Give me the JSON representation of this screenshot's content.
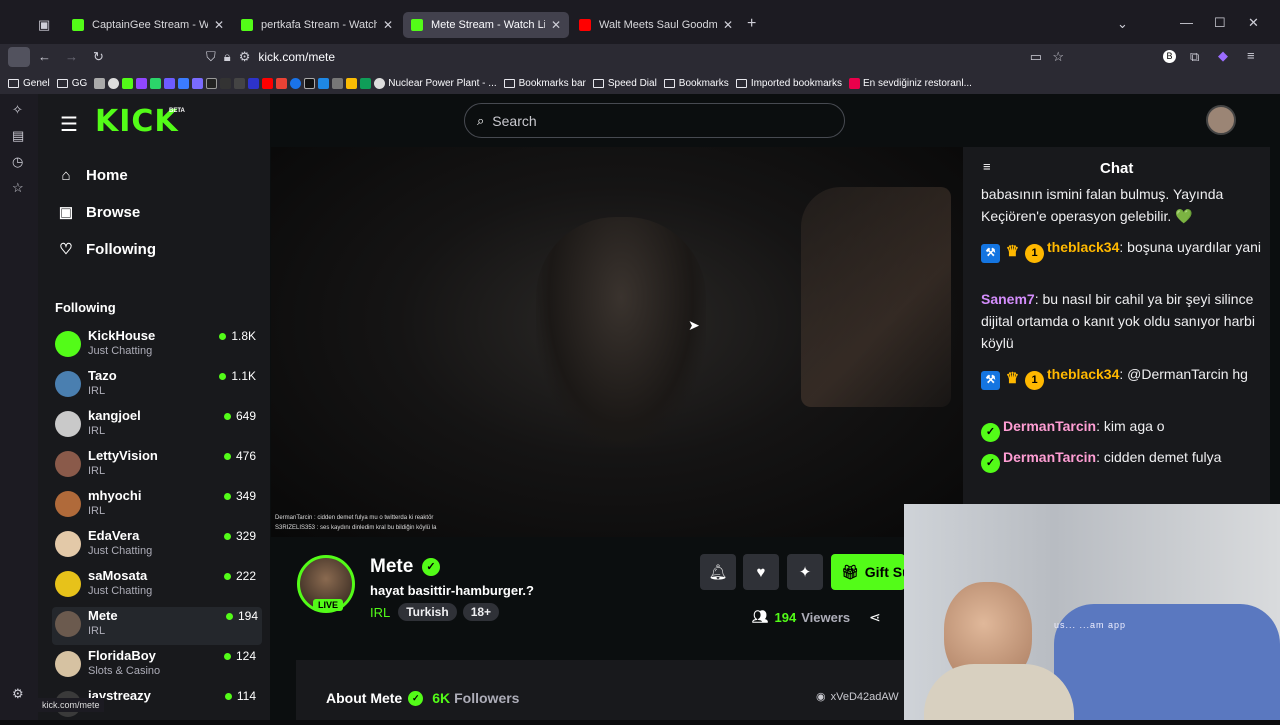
{
  "browser": {
    "tabs": [
      {
        "title": "CaptainGee Stream - Watch Live",
        "color": "#53fc18"
      },
      {
        "title": "pertkafa Stream - Watch Live o",
        "color": "#53fc18"
      },
      {
        "title": "Mete Stream - Watch Live on Ki",
        "color": "#53fc18",
        "active": true
      },
      {
        "title": "Walt Meets Saul Goodman For",
        "color": "#ff0000"
      }
    ],
    "url": "kick.com/mete",
    "bookmarks": [
      "Genel",
      "GG",
      "Nuclear Power Plant - ...",
      "Bookmarks bar",
      "Speed Dial",
      "Bookmarks",
      "Imported bookmarks",
      "En sevdiğiniz restoranl..."
    ],
    "status_url": "kick.com/mete"
  },
  "kick": {
    "logo": "KICK",
    "logo_badge": "BETA",
    "search_placeholder": "Search",
    "nav": {
      "home": "Home",
      "browse": "Browse",
      "following": "Following"
    },
    "following_header": "Following",
    "following": [
      {
        "name": "KickHouse",
        "category": "Just Chatting",
        "viewers": "1.8K"
      },
      {
        "name": "Tazo",
        "category": "IRL",
        "viewers": "1.1K"
      },
      {
        "name": "kangjoel",
        "category": "IRL",
        "viewers": "649"
      },
      {
        "name": "LettyVision",
        "category": "IRL",
        "viewers": "476"
      },
      {
        "name": "mhyochi",
        "category": "IRL",
        "viewers": "349"
      },
      {
        "name": "EdaVera",
        "category": "Just Chatting",
        "viewers": "329"
      },
      {
        "name": "saMosata",
        "category": "Just Chatting",
        "viewers": "222"
      },
      {
        "name": "Mete",
        "category": "IRL",
        "viewers": "194"
      },
      {
        "name": "FloridaBoy",
        "category": "Slots & Casino",
        "viewers": "124"
      },
      {
        "name": "jaystreazy",
        "category": "",
        "viewers": "114"
      }
    ],
    "video_overlay": [
      "DermanTarcin : cidden demet fulya mu o twitterda ki reaktör",
      "S3RIZELIS353 : ses kaydını dinledim kral bu bildiğin köylü la"
    ],
    "channel": {
      "name": "Mete",
      "title": "hayat basittir-hamburger.?",
      "category": "IRL",
      "tags": [
        "Turkish",
        "18+"
      ],
      "live_label": "LIVE",
      "viewers": "194",
      "viewers_label": "Viewers",
      "gift_label": "Gift Su",
      "about_label": "About Mete",
      "followers": "6K",
      "followers_label": "Followers",
      "wallet": "xVeD42adAW"
    },
    "chat": {
      "title": "Chat",
      "messages": [
        {
          "user": "",
          "text": "babasının ismini falan bulmuş. Yayında Keçiören'e operasyon gelebilir. 💚",
          "color": "#ffffff"
        },
        {
          "user": "theblack34",
          "text": ": boşuna uyardılar yani",
          "color": "#ffb800",
          "badges": true
        },
        {
          "user": "Sanem7",
          "text": ": bu nasıl bir cahil ya bir şeyi silince dijital ortamda o kanıt yok oldu sanıyor harbi köylü",
          "color": "#d48dfc"
        },
        {
          "user": "theblack34",
          "text": ": @DermanTarcin hg",
          "color": "#ffb800",
          "badges": true
        },
        {
          "user": "DermanTarcin",
          "text": ": kim aga o",
          "color": "#ff9ed4",
          "verified": true
        },
        {
          "user": "DermanTarcin",
          "text": ": cidden demet fulya",
          "color": "#ff9ed4",
          "verified": true
        }
      ]
    },
    "webcam_text": "us... ...am app"
  }
}
